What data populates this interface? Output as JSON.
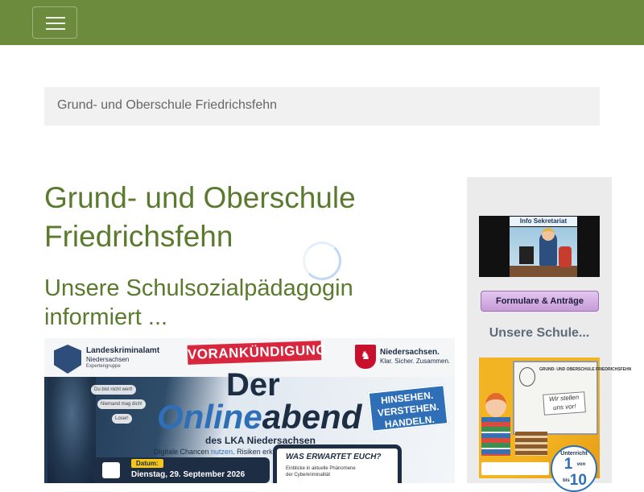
{
  "navbar": {
    "toggle_icon": "hamburger-icon",
    "background": "#6d8b3d"
  },
  "breadcrumb": {
    "text": "Grund- und Oberschule Friedrichsfehn"
  },
  "main": {
    "page_title": "Grund- und Oberschule Friedrichsfehn",
    "section_title": "Unsere Schulsozialpädagogin informiert ...",
    "accent_color": "#5a7a2e"
  },
  "flyer": {
    "org": "Landeskriminalamt",
    "org_sub": "Niedersachsen",
    "org_sub2": "Expertengruppe",
    "vorankuendigung": "VORANKÜNDIGUNG",
    "state": "Niedersachsen.",
    "state_sub": "Klar. Sicher. Zusammen.",
    "der": "Der",
    "online": "Online",
    "abend": "abend",
    "lka": "des LKA Niedersachsen",
    "digital_a": "Digitale Chancen ",
    "digital_b": "nutzen",
    "digital_c": ". Risiken erkennen. Gemeinsam handeln.",
    "slogan_1": "HINSEHEN.",
    "slogan_2": "VERSTEHEN.",
    "slogan_3": "HANDELN.",
    "date_label": "Datum:",
    "date_value": "Dienstag, 29. September 2026",
    "was": "WAS ERWARTET EUCH?",
    "bullet_1": "Einblicke in aktuelle Phänomene",
    "bullet_2": "der Cyberkriminalität",
    "chat_1": "Du bist nicht wert!",
    "chat_2": "Niemand mag dich!",
    "chat_3": "Loser!"
  },
  "sidebar": {
    "sekretariat_label": "Info Sekretariat",
    "forms_button": "Formulare & Anträge",
    "schule_heading": "Unsere Schule...",
    "schule_board_title": "GRUND- UND OBERSCHULE FRIEDRICHSFEHN",
    "schule_note": "Wir stellen uns vor!",
    "schule_unterricht": "Unterricht",
    "schule_num_from": "1",
    "schule_von": "von",
    "schule_bis": "bis",
    "schule_num_to": "10"
  }
}
